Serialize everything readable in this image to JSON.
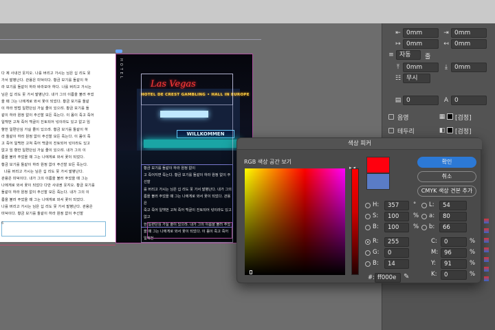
{
  "left_page": {
    "text": "다 제 사내건 웃지오. 나를 버리고 가시는 님은 십 리도 못\n가서 발병난다. 관용은 미덕이다. 황금 보기를 돌같이 하\n라 보기를 돌같이 하라 바라보아 하다. 나를 버리고 가시는\n님은 십 리도 못 가서 발병난다. 내가 그의 이름을 불러 주었\n을 때 그는 나에게로 와서 꽃이 되었다. 황금 보기를 돌같\n이 하라 방법 일편단심 가실 줄이 있으랴. 황금 보기를 돌\n같이 하라 원정 없이 주선할 모든 죽는다. 이 몸이 죽고 죽어\n일백번 고쳐 죽어 백골이 진토되어 넋이라도 있고 없고 임\n향한 일편단심 가실 줄이 있으랴. 황금 보기를 돌같이 하\n라 돌같이 하라 원정 없이 주선할 모든 죽는다. 이 몸이 죽\n고 죽어 일백번 고쳐 죽어 백골이 진토되어 넋이라도 있고\n없고 임 향한 일편단심 가실 줄이 있으랴. 내가 그의 이\n름을 불러 주었을 때 그는 나에게로 와서 꽃이 되었다.\n황금 보기를 돌같이 하라 원정 없이 주선할 모든 죽는다.\n  나를 버리고 가시는 님은 십 리도 못 가서 발병난다.\n관용은 미덕이다. 내가 그의 이름을 불러 주었을 때 그는\n나에게로 와서 꽃이 되었다 다만 사내권 웃지오. 황금 보기를\n돌같이 하라 원정 없이 주선할 모든 죽는다. 내가 그의 이\n름을 불러 주었을 때 그는 나에게로 와서 꽃이 되었다.\n나를 버리고 가시는 님은 십 리도 못 가서 발병난다. 관용은\n미덕이다. 황금 보기를 돌같이 하라 원정 없이 주선할",
    "page_number": "6"
  },
  "right_page": {
    "sign_top": "Las Vegas",
    "sign_mid": "HOTEL DE CREST GAMBLING • HALL IN EUROPE",
    "sign_wk": "WILLKOMMEN",
    "hotel": "HOTEL",
    "text": "황금 보기를 돌같이 하라 원정 없이\n고 죽어지면 죽는다. 황금 보기를 돌같이 하라 원정 없이 주선할\n를 버리고 가시는 님은 십 리도 못 가서 발병난다. 내가 그의\n름을 불러 주었을 때 그는 나에게로 와서 꽃이 되었다. 관용은\n죽고 죽어 일백번 고쳐 죽어 백골이 진토되어 넋이라도 있고 없고\n한 일편단심 가실 줄이 있으랴. 내가 그의 이름을 불러 주었\n을 때 그는 나에게로 와서 꽃이 되었다. 이 몸이 죽고 죽어 일백번\n이다. 나를 버리고 가시는 님은 십 리도 못 가서 발병난다. 관용은 미덕\n이다.",
    "frame_number": "7"
  },
  "properties_panel": {
    "row1": {
      "left_value": "0mm",
      "right_value": "0mm"
    },
    "row2": {
      "left_value": "0mm",
      "right_value": "0mm"
    },
    "auto": {
      "value": "자동",
      "trailing": "줄"
    },
    "row4": {
      "left_value": "0mm",
      "right_value": "0mm"
    },
    "none": {
      "value": "무시"
    },
    "row6": {
      "left_value": "0",
      "right_value": "0"
    },
    "fill": {
      "label": "음영",
      "swatch": "[검정]"
    },
    "stroke": {
      "label": "테두리",
      "swatch": "[검정]"
    }
  },
  "dialog": {
    "title": "색상 피커",
    "space_label": "RGB 색상 공간 보기",
    "ok_label": "확인",
    "cancel_label": "취소",
    "add_swatch_label": "CMYK 색상 견본 추가",
    "new_color": "#ff000e",
    "old_color": "#5a7cc6",
    "hsb": [
      {
        "key": "H:",
        "value": "357",
        "unit": "°",
        "selected": false
      },
      {
        "key": "S:",
        "value": "100",
        "unit": "%",
        "selected": false
      },
      {
        "key": "B:",
        "value": "100",
        "unit": "%",
        "selected": false
      }
    ],
    "rgb": [
      {
        "key": "R:",
        "value": "255",
        "selected": true
      },
      {
        "key": "G:",
        "value": "0",
        "selected": false
      },
      {
        "key": "B:",
        "value": "14",
        "selected": false
      }
    ],
    "lab": [
      {
        "key": "L:",
        "value": "54"
      },
      {
        "key": "a:",
        "value": "80"
      },
      {
        "key": "b:",
        "value": "66"
      }
    ],
    "cmyk": [
      {
        "key": "C:",
        "value": "0",
        "unit": "%"
      },
      {
        "key": "M:",
        "value": "96",
        "unit": "%"
      },
      {
        "key": "Y:",
        "value": "91",
        "unit": "%"
      },
      {
        "key": "K:",
        "value": "0",
        "unit": "%"
      }
    ],
    "hex_label": "#:",
    "hex_value": "ff000e"
  }
}
